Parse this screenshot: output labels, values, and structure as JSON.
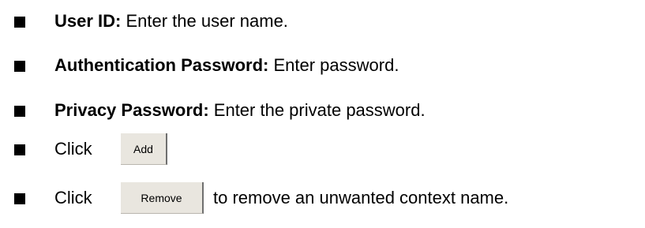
{
  "items": [
    {
      "label": "User ID:",
      "desc": " Enter the user name."
    },
    {
      "label": "Authentication Password:",
      "desc": " Enter password."
    },
    {
      "label": "Privacy Password:",
      "desc": " Enter the private password."
    }
  ],
  "add_row": {
    "prefix": "Click",
    "button_label": "Add"
  },
  "remove_row": {
    "prefix": "Click",
    "button_label": "Remove",
    "suffix": "to remove an unwanted context name."
  }
}
